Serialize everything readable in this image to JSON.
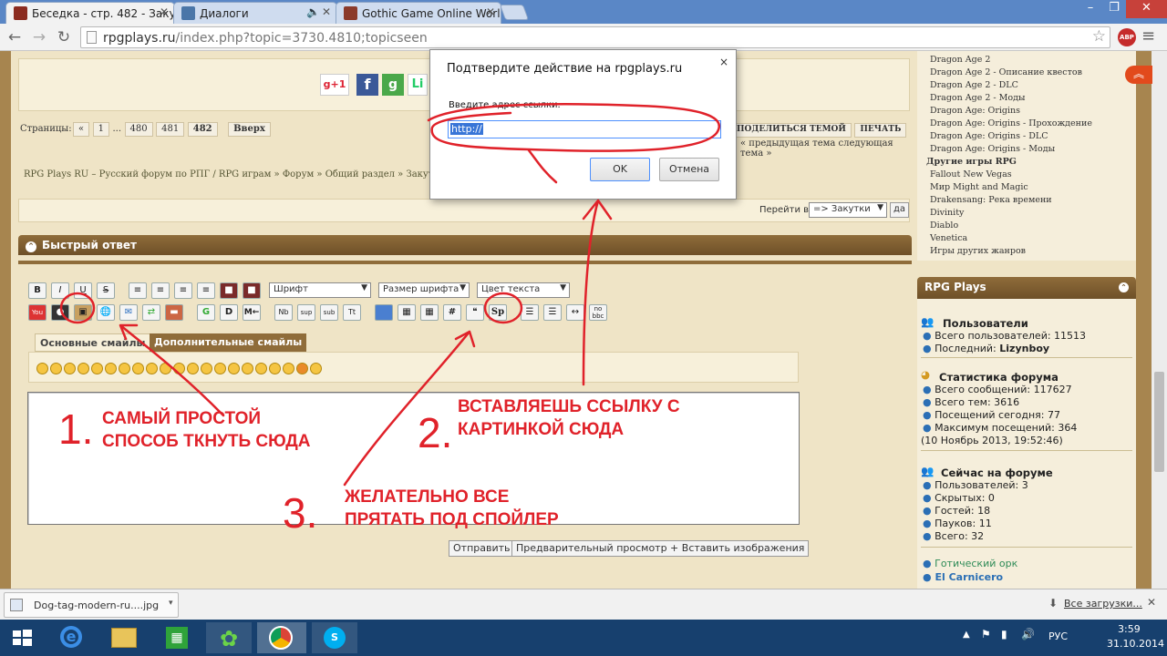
{
  "browser": {
    "tabs": [
      {
        "title": "Беседка - стр. 482 - Закут",
        "icon_color": "#a52a2a"
      },
      {
        "title": "Диалоги",
        "icon_color": "#4a76a8"
      },
      {
        "title": "Gothic Game Online Worl",
        "icon_color": "#8b3a2a"
      }
    ],
    "url_host": "rpgplays.ru",
    "url_rest": "/index.php?topic=3730.4810;topicseen",
    "window_buttons": [
      "–",
      "❐",
      "✕"
    ],
    "ext_badge": "ABP"
  },
  "forum": {
    "share_icons": [
      "g+1",
      "f",
      "g",
      "Li"
    ],
    "pages_label": "Страницы:",
    "pages": [
      "«",
      "1",
      "...",
      "480",
      "481",
      "482"
    ],
    "up_label": "Вверх",
    "share_topic": "ПОДЕЛИТЬСЯ ТЕМОЙ",
    "print": "ПЕЧАТЬ",
    "prev_next": "« предыдущая тема следующая тема »",
    "breadcrumb": "RPG Plays RU – Русский форум по РПГ / RPG играм » Форум » Общий раздел » Закутки (Ме",
    "jump_label": "Перейти в:",
    "jump_value": "=> Закутки",
    "jump_go": "да",
    "quick_reply": "Быстрый ответ",
    "font_select": "Шрифт",
    "size_select": "Размер шрифта",
    "color_select": "Цвет текста",
    "smiley_tabs": [
      "Основные смайлы",
      "Дополнительные смайлы"
    ],
    "submit": "Отправить",
    "preview": "Предварительный просмотр + Вставить изображения"
  },
  "sidebar": {
    "games": [
      "Dragon Age 2",
      "Dragon Age 2 - Описание квестов",
      "Dragon Age 2 - DLC",
      "Dragon Age 2 - Моды",
      "Dragon Age: Origins",
      "Dragon Age: Origins - Прохождение",
      "Dragon Age: Origins - DLC",
      "Dragon Age: Origins - Моды",
      "Другие игры RPG",
      "Fallout New Vegas",
      "Мир Might and Magic",
      "Drakensang: Река времени",
      "Divinity",
      "Diablo",
      "Venetica",
      "Игры других жанров"
    ],
    "panel_title": "RPG Plays",
    "users_head": "Пользователи",
    "users_total": "Всего пользователей: 11513",
    "users_last_label": "Последний:",
    "users_last": "Lizynboy",
    "stats_head": "Статистика форума",
    "stats": [
      "Всего сообщений: 117627",
      "Всего тем: 3616",
      "Посещений сегодня: 77",
      "Максимум посещений: 364"
    ],
    "stats_date": "(10 Ноябрь 2013, 19:52:46)",
    "online_head": "Сейчас на форуме",
    "online": [
      "Пользователей: 3",
      "Скрытых: 0",
      "Гостей: 18",
      "Пауков: 11",
      "Всего: 32"
    ],
    "online_users": [
      "Готический орк",
      "El Carnicero"
    ]
  },
  "dialog": {
    "title": "Подтвердите действие на rpgplays.ru",
    "label": "Введите адрес ссылки.",
    "value": "http://",
    "ok": "OK",
    "cancel": "Отмена",
    "close": "×"
  },
  "annotations": {
    "a1_line1": "САМЫЙ ПРОСТОЙ",
    "a1_line2": "СПОСОБ ТКНУТЬ СЮДА",
    "a2_line1": "ВСТАВЛЯЕШЬ ССЫЛКУ С",
    "a2_line2": "КАРТИНКОЙ СЮДА",
    "a3_line1": "ЖЕЛАТЕЛЬНО ВСЕ",
    "a3_line2": "ПРЯТАТЬ ПОД СПОЙЛЕР",
    "n1": "1.",
    "n2": "2.",
    "n3": "3."
  },
  "download": {
    "file": "Dog-tag-modern-ru....jpg",
    "all": "Все загрузки..."
  },
  "taskbar": {
    "lang": "РУС",
    "time": "3:59",
    "date": "31.10.2014"
  }
}
